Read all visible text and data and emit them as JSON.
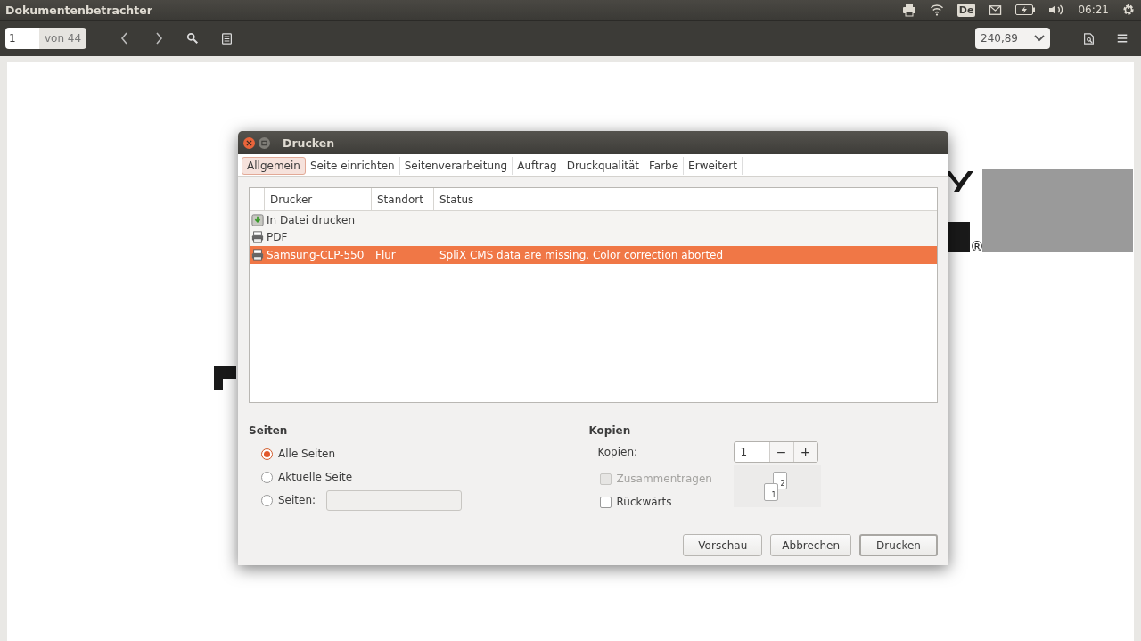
{
  "top_bar": {
    "app_title": "Dokumentenbetrachter",
    "keyboard_layout": "De",
    "clock": "06:21"
  },
  "toolbar": {
    "page_number": "1",
    "page_count": "von 44",
    "zoom": "240,89"
  },
  "document": {
    "mark": "®"
  },
  "dialog": {
    "title": "Drucken",
    "tabs": [
      {
        "label": "Allgemein",
        "selected": true
      },
      {
        "label": "Seite einrichten",
        "selected": false
      },
      {
        "label": "Seitenverarbeitung",
        "selected": false
      },
      {
        "label": "Auftrag",
        "selected": false
      },
      {
        "label": "Druckqualität",
        "selected": false
      },
      {
        "label": "Farbe",
        "selected": false
      },
      {
        "label": "Erweitert",
        "selected": false
      }
    ],
    "printer_table": {
      "columns": [
        "Drucker",
        "Standort",
        "Status"
      ],
      "rows": [
        {
          "kind": "file",
          "name": "In Datei drucken",
          "location": "",
          "status": "",
          "selected": false
        },
        {
          "kind": "printer",
          "name": "PDF",
          "location": "",
          "status": "",
          "selected": false
        },
        {
          "kind": "printer",
          "name": "Samsung-CLP-550",
          "location": "Flur",
          "status": "SpliX CMS data are missing. Color correction aborted",
          "selected": true
        }
      ]
    },
    "pages": {
      "title": "Seiten",
      "options": [
        {
          "label": "Alle Seiten",
          "selected": true
        },
        {
          "label": "Aktuelle Seite",
          "selected": false
        },
        {
          "label": "Seiten:",
          "selected": false
        }
      ]
    },
    "copies": {
      "title": "Kopien",
      "label": "Kopien:",
      "value": "1",
      "minus": "−",
      "plus": "+",
      "collate": {
        "label": "Zusammentragen",
        "checked": false,
        "disabled": true
      },
      "reverse": {
        "label": "Rückwärts",
        "checked": false,
        "disabled": false
      },
      "preview_pages": [
        "1",
        "2"
      ]
    },
    "buttons": [
      {
        "label": "Vorschau",
        "kind": "normal"
      },
      {
        "label": "Abbrechen",
        "kind": "normal"
      },
      {
        "label": "Drucken",
        "kind": "default"
      }
    ]
  }
}
